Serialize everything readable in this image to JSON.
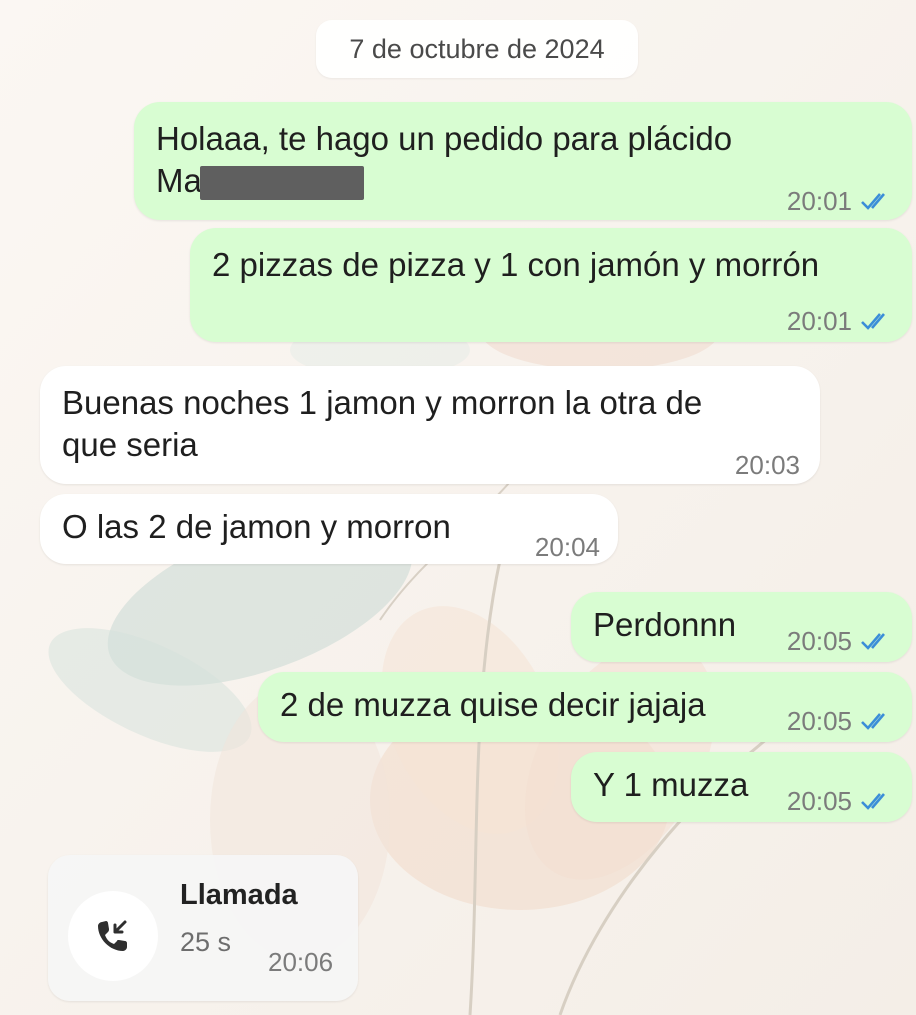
{
  "date_chip": "7 de octubre de 2024",
  "messages": [
    {
      "direction": "outgoing",
      "lines": [
        "Holaaa, te hago un pedido para plácido",
        "Ma"
      ],
      "time": "20:01",
      "status_icon": "double-check-read-icon"
    },
    {
      "direction": "outgoing",
      "lines": [
        "2 pizzas de pizza y 1 con jamón y morrón"
      ],
      "time": "20:01",
      "status_icon": "double-check-read-icon"
    },
    {
      "direction": "incoming",
      "lines": [
        "Buenas noches 1 jamon y morron la otra de",
        "que seria"
      ],
      "time": "20:03"
    },
    {
      "direction": "incoming",
      "lines": [
        "O las 2 de jamon y morron"
      ],
      "time": "20:04"
    },
    {
      "direction": "outgoing",
      "lines": [
        "Perdonnn"
      ],
      "time": "20:05",
      "status_icon": "double-check-read-icon"
    },
    {
      "direction": "outgoing",
      "lines": [
        "2 de muzza quise decir jajaja"
      ],
      "time": "20:05",
      "status_icon": "double-check-read-icon"
    },
    {
      "direction": "outgoing",
      "lines": [
        "Y 1 muzza"
      ],
      "time": "20:05",
      "status_icon": "double-check-read-icon"
    }
  ],
  "call": {
    "label": "Llamada",
    "duration": "25 s",
    "time": "20:06",
    "icon": "incoming-call-icon"
  },
  "colors": {
    "outgoing_bubble": "#d8fdd2",
    "incoming_bubble": "#ffffff",
    "read_ticks": "#3b8ed8",
    "timestamp": "#7b7b7b"
  }
}
